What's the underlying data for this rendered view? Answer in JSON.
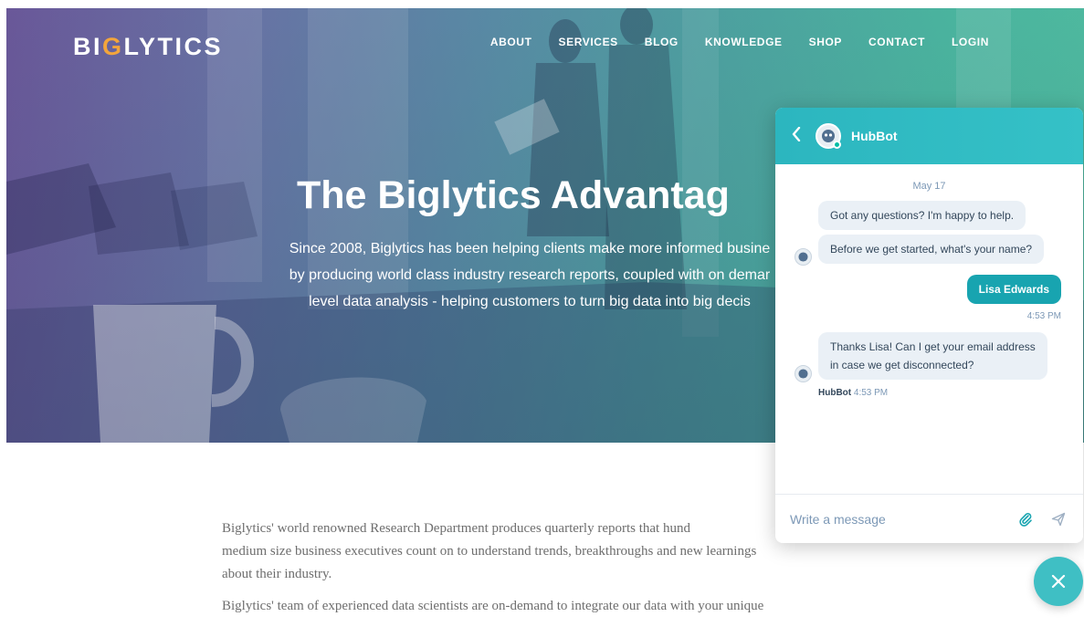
{
  "site": {
    "logo_pre": "BI",
    "logo_accent": "G",
    "logo_post": "LYTICS",
    "nav": [
      "ABOUT",
      "SERVICES",
      "BLOG",
      "KNOWLEDGE",
      "SHOP",
      "CONTACT",
      "LOGIN"
    ]
  },
  "hero": {
    "title": "The Biglytics Advantag",
    "subtitle_lines": [
      "Since 2008, Biglytics has been helping clients make more informed busine",
      "by producing world class industry research reports, coupled with on demar",
      "level data analysis - helping customers to turn big data into big decis"
    ]
  },
  "body": {
    "paragraph1_lines": [
      "Biglytics' world renowned Research Department produces quarterly reports that hund",
      "medium size business executives count on to understand trends, breakthroughs and new learnings",
      "about their industry."
    ],
    "paragraph2": "Biglytics' team of experienced data scientists are on-demand to integrate our data with your unique"
  },
  "chat": {
    "bot_name": "HubBot",
    "date": "May 17",
    "messages": [
      {
        "from": "bot",
        "text": "Got any questions? I'm happy to help."
      },
      {
        "from": "bot",
        "text": "Before we get started, what's your name?"
      },
      {
        "from": "user",
        "text": "Lisa Edwards",
        "time": "4:53 PM"
      },
      {
        "from": "bot",
        "text_lines": [
          "Thanks Lisa! Can I get your email address",
          "in case we get disconnected?"
        ],
        "sender": "HubBot",
        "time": "4:53 PM"
      }
    ],
    "input_placeholder": "Write a message"
  },
  "colors": {
    "accent": "#2cb6bf",
    "user_bubble": "#18a4b0",
    "bot_bubble": "#eaf0f6",
    "logo_accent": "#f3a53c"
  },
  "icons": {
    "back": "chevron-left-icon",
    "attach": "paperclip-icon",
    "send": "send-icon",
    "close": "close-icon"
  }
}
